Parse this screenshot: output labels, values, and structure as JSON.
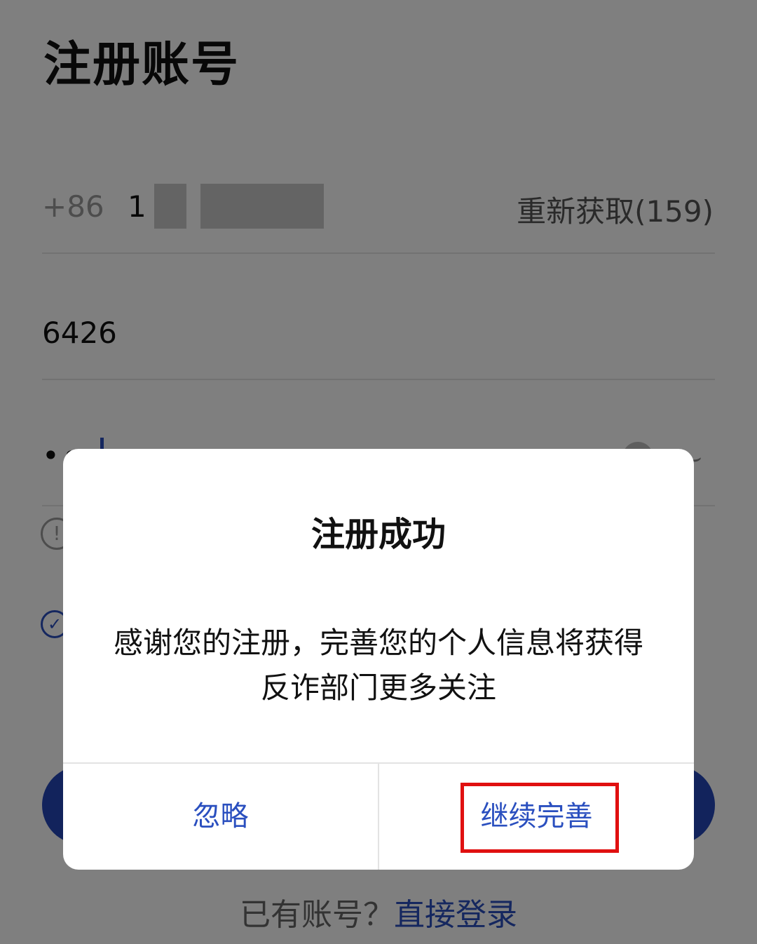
{
  "page": {
    "title": "注册账号",
    "phone": {
      "country_code": "+86",
      "number_visible": "1",
      "resend_label": "重新获取(159)"
    },
    "verification_code": "6426",
    "password_masked": "••",
    "hint_icon_glyph": "!",
    "agree_icon_glyph": "✓",
    "footer": {
      "prompt": "已有账号？",
      "login_link": "直接登录"
    }
  },
  "dialog": {
    "title": "注册成功",
    "message": "感谢您的注册，完善您的个人信息将获得反诈部门更多关注",
    "ignore_button": "忽略",
    "continue_button": "继续完善",
    "highlight_color": "#e01010"
  },
  "colors": {
    "accent": "#2a4fbf",
    "primary_button": "#2447b8",
    "overlay": "rgba(0,0,0,0.5)"
  }
}
